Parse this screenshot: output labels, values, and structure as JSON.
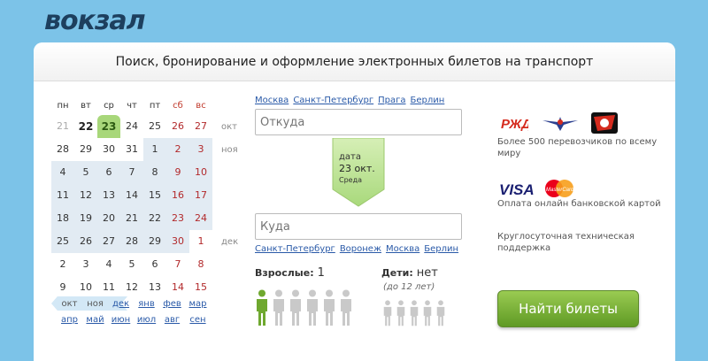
{
  "brand": {
    "logo": "вокзал"
  },
  "header": {
    "title": "Поиск, бронирование и оформление электронных билетов на транспорт"
  },
  "calendar": {
    "weekdays": [
      {
        "label": "пн",
        "weekend": false
      },
      {
        "label": "вт",
        "weekend": false
      },
      {
        "label": "ср",
        "weekend": false
      },
      {
        "label": "чт",
        "weekend": false
      },
      {
        "label": "пт",
        "weekend": false
      },
      {
        "label": "сб",
        "weekend": true
      },
      {
        "label": "вс",
        "weekend": true
      }
    ],
    "rows": [
      {
        "month": "окт",
        "days": [
          {
            "d": "21",
            "s": "dim"
          },
          {
            "d": "22",
            "s": "bold"
          },
          {
            "d": "23",
            "s": "today"
          },
          {
            "d": "24",
            "s": ""
          },
          {
            "d": "25",
            "s": ""
          },
          {
            "d": "26",
            "s": "we"
          },
          {
            "d": "27",
            "s": "we"
          }
        ]
      },
      {
        "month": "ноя",
        "days": [
          {
            "d": "28",
            "s": ""
          },
          {
            "d": "29",
            "s": ""
          },
          {
            "d": "30",
            "s": ""
          },
          {
            "d": "31",
            "s": ""
          },
          {
            "d": "1",
            "s": "shade"
          },
          {
            "d": "2",
            "s": "shade we"
          },
          {
            "d": "3",
            "s": "shade we"
          }
        ]
      },
      {
        "month": "",
        "days": [
          {
            "d": "4",
            "s": "shade"
          },
          {
            "d": "5",
            "s": "shade"
          },
          {
            "d": "6",
            "s": "shade"
          },
          {
            "d": "7",
            "s": "shade"
          },
          {
            "d": "8",
            "s": "shade"
          },
          {
            "d": "9",
            "s": "shade we"
          },
          {
            "d": "10",
            "s": "shade we"
          }
        ]
      },
      {
        "month": "",
        "days": [
          {
            "d": "11",
            "s": "shade"
          },
          {
            "d": "12",
            "s": "shade"
          },
          {
            "d": "13",
            "s": "shade"
          },
          {
            "d": "14",
            "s": "shade"
          },
          {
            "d": "15",
            "s": "shade"
          },
          {
            "d": "16",
            "s": "shade we"
          },
          {
            "d": "17",
            "s": "shade we"
          }
        ]
      },
      {
        "month": "",
        "days": [
          {
            "d": "18",
            "s": "shade"
          },
          {
            "d": "19",
            "s": "shade"
          },
          {
            "d": "20",
            "s": "shade"
          },
          {
            "d": "21",
            "s": "shade"
          },
          {
            "d": "22",
            "s": "shade"
          },
          {
            "d": "23",
            "s": "shade we"
          },
          {
            "d": "24",
            "s": "shade we"
          }
        ]
      },
      {
        "month": "дек",
        "days": [
          {
            "d": "25",
            "s": "shade"
          },
          {
            "d": "26",
            "s": "shade"
          },
          {
            "d": "27",
            "s": "shade"
          },
          {
            "d": "28",
            "s": "shade"
          },
          {
            "d": "29",
            "s": "shade"
          },
          {
            "d": "30",
            "s": "shade we"
          },
          {
            "d": "1",
            "s": "we"
          }
        ]
      },
      {
        "month": "",
        "days": [
          {
            "d": "2",
            "s": ""
          },
          {
            "d": "3",
            "s": ""
          },
          {
            "d": "4",
            "s": ""
          },
          {
            "d": "5",
            "s": ""
          },
          {
            "d": "6",
            "s": ""
          },
          {
            "d": "7",
            "s": "we"
          },
          {
            "d": "8",
            "s": "we"
          }
        ]
      },
      {
        "month": "",
        "days": [
          {
            "d": "9",
            "s": ""
          },
          {
            "d": "10",
            "s": ""
          },
          {
            "d": "11",
            "s": ""
          },
          {
            "d": "12",
            "s": ""
          },
          {
            "d": "13",
            "s": ""
          },
          {
            "d": "14",
            "s": "we"
          },
          {
            "d": "15",
            "s": "we"
          }
        ]
      }
    ],
    "months_row1": [
      {
        "label": "окт",
        "active": false
      },
      {
        "label": "ноя",
        "active": false
      },
      {
        "label": "дек",
        "active": true
      },
      {
        "label": "янв",
        "active": true
      },
      {
        "label": "фев",
        "active": true
      },
      {
        "label": "мар",
        "active": true
      }
    ],
    "months_row2": [
      {
        "label": "апр",
        "active": true
      },
      {
        "label": "май",
        "active": true
      },
      {
        "label": "июн",
        "active": true
      },
      {
        "label": "июл",
        "active": true
      },
      {
        "label": "авг",
        "active": true
      },
      {
        "label": "сен",
        "active": true
      }
    ]
  },
  "from": {
    "quick_links": [
      "Москва",
      "Санкт-Петербург",
      "Прага",
      "Берлин"
    ],
    "placeholder": "Откуда"
  },
  "date": {
    "label": "дата",
    "value": "23 окт.",
    "weekday": "Среда"
  },
  "to": {
    "quick_links": [
      "Санкт-Петербург",
      "Воронеж",
      "Москва",
      "Берлин"
    ],
    "placeholder": "Куда"
  },
  "passengers": {
    "adults_label": "Взрослые:",
    "adults_value": "1",
    "adults_selected": 1,
    "adults_max": 6,
    "children_label": "Дети:",
    "children_value": "нет",
    "children_note": "(до 12 лет)",
    "children_max": 5
  },
  "sidebar": {
    "carriers_text": "Более 500 перевозчиков по всему миру",
    "payment_text": "Оплата онлайн банковской картой",
    "support_text": "Круглосуточная техническая поддержка",
    "rzd_logo": "РЖД",
    "visa_logo": "VISA",
    "mastercard_logo": "MasterCard"
  },
  "actions": {
    "search_button": "Найти билеты"
  },
  "colors": {
    "accent_green": "#7ab53a",
    "link_blue": "#2a5aa8",
    "weekend_red": "#b2292b",
    "background": "#7cc3e8"
  }
}
